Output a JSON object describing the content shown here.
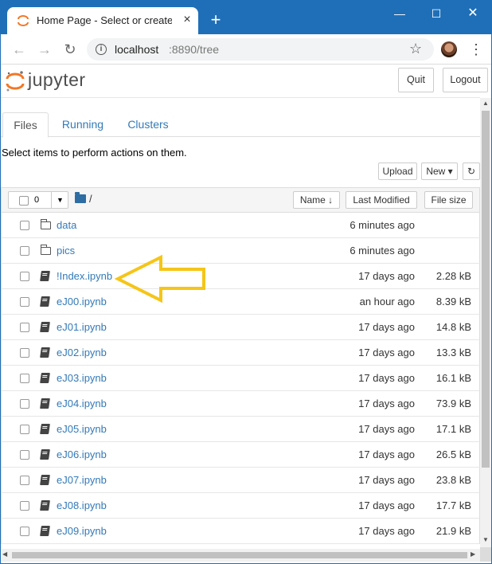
{
  "browser": {
    "tab_title": "Home Page - Select or create a n",
    "close_glyph": "×",
    "new_tab_glyph": "+",
    "window_controls": {
      "minimize": "—",
      "maximize": "☐",
      "close": "✕"
    },
    "url_host": "localhost",
    "url_rest": ":8890/tree",
    "nav": {
      "back": "←",
      "forward": "→",
      "reload": "↻",
      "star": "☆",
      "menu": "⋮",
      "info": "i"
    }
  },
  "jupyter": {
    "wordmark": "jupyter",
    "quit_label": "Quit",
    "logout_label": "Logout",
    "tabs": [
      {
        "label": "Files",
        "active": true
      },
      {
        "label": "Running",
        "active": false
      },
      {
        "label": "Clusters",
        "active": false
      }
    ],
    "hint": "Select items to perform actions on them.",
    "upload_label": "Upload",
    "new_label": "New ▾",
    "refresh_glyph": "↻",
    "select_count": "0",
    "select_caret": "▼",
    "breadcrumb": "/",
    "columns": {
      "name": "Name ↓",
      "modified": "Last Modified",
      "size": "File size"
    },
    "accent_color": "#337ab7",
    "logo_color": "#f37726"
  },
  "files": [
    {
      "type": "folder",
      "name": "data",
      "modified": "6 minutes ago",
      "size": ""
    },
    {
      "type": "folder",
      "name": "pics",
      "modified": "6 minutes ago",
      "size": ""
    },
    {
      "type": "notebook",
      "name": "!Index.ipynb",
      "modified": "17 days ago",
      "size": "2.28 kB"
    },
    {
      "type": "notebook",
      "name": "eJ00.ipynb",
      "modified": "an hour ago",
      "size": "8.39 kB"
    },
    {
      "type": "notebook",
      "name": "eJ01.ipynb",
      "modified": "17 days ago",
      "size": "14.8 kB"
    },
    {
      "type": "notebook",
      "name": "eJ02.ipynb",
      "modified": "17 days ago",
      "size": "13.3 kB"
    },
    {
      "type": "notebook",
      "name": "eJ03.ipynb",
      "modified": "17 days ago",
      "size": "16.1 kB"
    },
    {
      "type": "notebook",
      "name": "eJ04.ipynb",
      "modified": "17 days ago",
      "size": "73.9 kB"
    },
    {
      "type": "notebook",
      "name": "eJ05.ipynb",
      "modified": "17 days ago",
      "size": "17.1 kB"
    },
    {
      "type": "notebook",
      "name": "eJ06.ipynb",
      "modified": "17 days ago",
      "size": "26.5 kB"
    },
    {
      "type": "notebook",
      "name": "eJ07.ipynb",
      "modified": "17 days ago",
      "size": "23.8 kB"
    },
    {
      "type": "notebook",
      "name": "eJ08.ipynb",
      "modified": "17 days ago",
      "size": "17.7 kB"
    },
    {
      "type": "notebook",
      "name": "eJ09.ipynb",
      "modified": "17 days ago",
      "size": "21.9 kB"
    }
  ],
  "annotation": {
    "color": "#f5c518",
    "points_to": "!Index.ipynb"
  },
  "scrollbars": {
    "up": "▲",
    "down": "▼",
    "left": "◀",
    "right": "▶"
  }
}
